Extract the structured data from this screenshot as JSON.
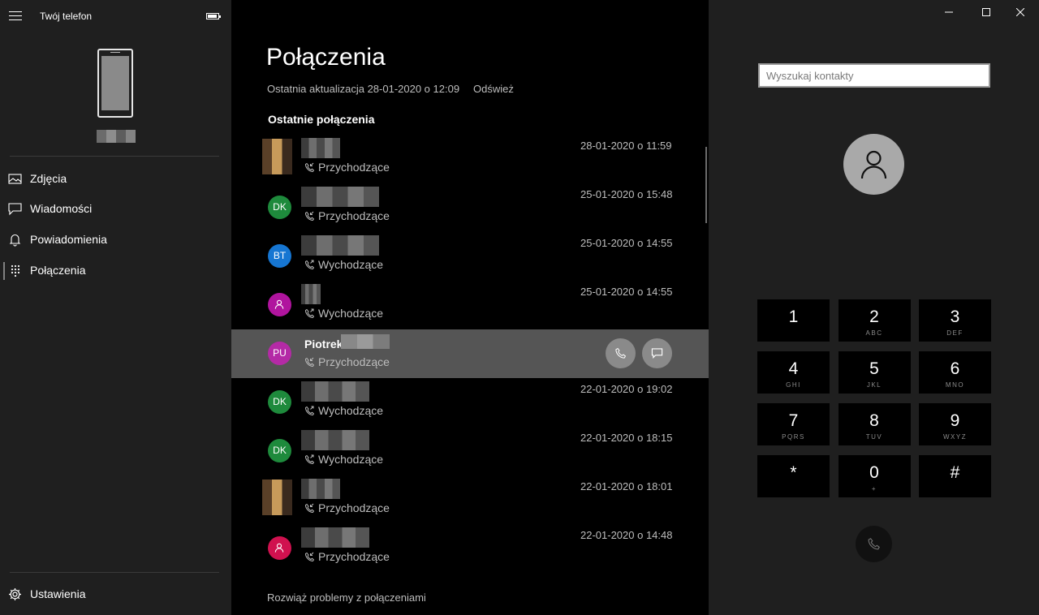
{
  "app": {
    "title": "Twój telefon"
  },
  "sidebar": {
    "nav": [
      {
        "label": "Zdjęcia",
        "icon": "photos-icon"
      },
      {
        "label": "Wiadomości",
        "icon": "messages-icon"
      },
      {
        "label": "Powiadomienia",
        "icon": "bell-icon"
      },
      {
        "label": "Połączenia",
        "icon": "dialpad-icon"
      }
    ],
    "settings_label": "Ustawienia"
  },
  "calls": {
    "title": "Połączenia",
    "last_update": "Ostatnia aktualizacja 28-01-2020 o 12:09",
    "refresh_label": "Odśwież",
    "recent_heading": "Ostatnie połączenia",
    "rows": [
      {
        "initials": "",
        "name": "",
        "type": "Przychodzące",
        "time": "28-01-2020 o 11:59",
        "avatar_kind": "photo"
      },
      {
        "initials": "DK",
        "name": "",
        "type": "Przychodzące",
        "time": "25-01-2020 o 15:48",
        "avatar_color": "#1e8a3c"
      },
      {
        "initials": "BT",
        "name": "",
        "type": "Wychodzące",
        "time": "25-01-2020 o 14:55",
        "avatar_color": "#1676d2"
      },
      {
        "initials": "",
        "name": "",
        "type": "Wychodzące",
        "time": "25-01-2020 o 14:55",
        "avatar_color": "#b0149e",
        "avatar_kind": "person"
      },
      {
        "initials": "PU",
        "name": "Piotrek",
        "type": "Przychodzące",
        "time": "",
        "avatar_color": "#b42aa6",
        "highlighted": true
      },
      {
        "initials": "DK",
        "name": "",
        "type": "Wychodzące",
        "time": "22-01-2020 o 19:02",
        "avatar_color": "#1e8a3c"
      },
      {
        "initials": "DK",
        "name": "",
        "type": "Wychodzące",
        "time": "22-01-2020 o 18:15",
        "avatar_color": "#1e8a3c"
      },
      {
        "initials": "",
        "name": "",
        "type": "Przychodzące",
        "time": "22-01-2020 o 18:01",
        "avatar_kind": "photo"
      },
      {
        "initials": "",
        "name": "",
        "type": "Przychodzące",
        "time": "22-01-2020 o 14:48",
        "avatar_color": "#d0114f",
        "avatar_kind": "person"
      }
    ],
    "troubleshoot_label": "Rozwiąż problemy z połączeniami"
  },
  "dialer": {
    "search_placeholder": "Wyszukaj kontakty",
    "keys": [
      {
        "digit": "1",
        "letters": ""
      },
      {
        "digit": "2",
        "letters": "ABC"
      },
      {
        "digit": "3",
        "letters": "DEF"
      },
      {
        "digit": "4",
        "letters": "GHI"
      },
      {
        "digit": "5",
        "letters": "JKL"
      },
      {
        "digit": "6",
        "letters": "MNO"
      },
      {
        "digit": "7",
        "letters": "PQRS"
      },
      {
        "digit": "8",
        "letters": "TUV"
      },
      {
        "digit": "9",
        "letters": "WXYZ"
      },
      {
        "digit": "*",
        "letters": ""
      },
      {
        "digit": "0",
        "letters": "+"
      },
      {
        "digit": "#",
        "letters": ""
      }
    ]
  }
}
